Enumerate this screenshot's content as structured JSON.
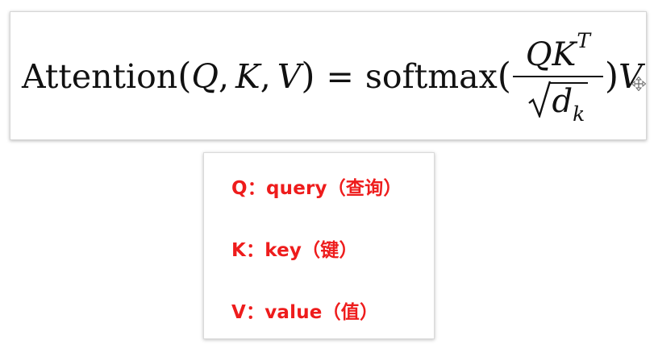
{
  "formula": {
    "lhs_name": "Attention",
    "open_paren": "(",
    "arg_q": "Q",
    "comma1": ",",
    "arg_k": "K",
    "comma2": ",",
    "arg_v": "V",
    "close_paren": ")",
    "equals": "=",
    "func": "softmax",
    "func_open": "(",
    "numerator_q": "Q",
    "numerator_k": "K",
    "numerator_sup": "T",
    "denominator_d": "d",
    "denominator_sub": "k",
    "func_close": ")",
    "rhs_v": "V"
  },
  "legend": {
    "items": [
      {
        "text": "Q：query（查询）"
      },
      {
        "text": "K：key（键）"
      },
      {
        "text": "V：value（值）"
      }
    ],
    "text_color": "#ee1c1c"
  },
  "icons": [
    "move-cursor-icon"
  ]
}
